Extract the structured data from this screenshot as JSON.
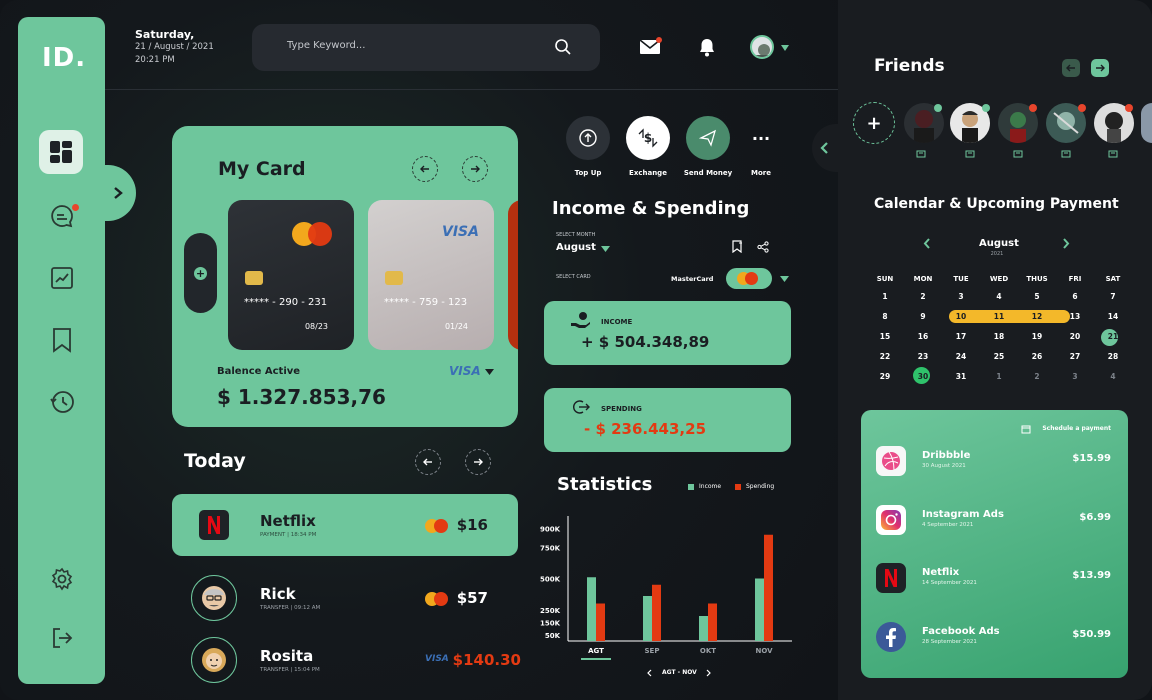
{
  "logo": "ID.",
  "datetime": {
    "day": "Saturday,",
    "date": "21 / August / 2021",
    "time": "20:21 PM"
  },
  "search": {
    "placeholder": "Type Keyword..."
  },
  "my_card": {
    "title": "My Card",
    "cards": [
      {
        "number": "***** - 290 - 231",
        "expiry": "08/23",
        "brand": "mastercard"
      },
      {
        "number": "***** - 759 - 123",
        "expiry": "01/24",
        "brand": "VISA"
      }
    ],
    "balance_label": "Balence Active",
    "balance": "$ 1.327.853,76",
    "brand_label": "VISA"
  },
  "today": {
    "title": "Today",
    "transactions": [
      {
        "name": "Netflix",
        "sub": "PAYMENT | 18:34 PM",
        "amount": "$16",
        "method": "mastercard"
      },
      {
        "name": "Rick",
        "sub": "TRANSFER | 09:12 AM",
        "amount": "$57",
        "method": "mastercard"
      },
      {
        "name": "Rosita",
        "sub": "TRANSFER | 15:04 PM",
        "amount": "$140.30",
        "method": "VISA"
      }
    ]
  },
  "quick_actions": [
    {
      "label": "Top Up"
    },
    {
      "label": "Exchange"
    },
    {
      "label": "Send Money"
    },
    {
      "label": "More",
      "icon": "···"
    }
  ],
  "income_spending": {
    "title": "Income & Spending",
    "month_label": "SELECT MONTH",
    "month": "August",
    "card_label": "SELECT CARD",
    "card": "MasterCard",
    "income_label": "INCOME",
    "income": "+ $ 504.348,89",
    "spending_label": "SPENDING",
    "spending": "- $ 236.443,25"
  },
  "statistics": {
    "title": "Statistics",
    "range_label": "AGT - NOV"
  },
  "chart_data": {
    "type": "bar",
    "title": "Statistics",
    "categories": [
      "AGT",
      "SEP",
      "OKT",
      "NOV"
    ],
    "series": [
      {
        "name": "Income",
        "values": [
          510,
          360,
          200,
          500
        ],
        "color": "#6ec69c"
      },
      {
        "name": "Spending",
        "values": [
          300,
          450,
          300,
          850
        ],
        "color": "#e33a12"
      }
    ],
    "y_ticks": [
      "900K",
      "750K",
      "500K",
      "250K",
      "150K",
      "50K"
    ],
    "ylim": [
      0,
      1000
    ],
    "selected_category": "AGT"
  },
  "friends": {
    "title": "Friends",
    "add_label": "+",
    "people": [
      {
        "status": "online",
        "color": "#2b2f33"
      },
      {
        "status": "online",
        "color": "#e8e8e8"
      },
      {
        "status": "busy",
        "color": "#2f3a3a"
      },
      {
        "status": "busy",
        "color": "#3c5a55"
      },
      {
        "status": "busy",
        "color": "#dddddd"
      }
    ]
  },
  "calendar": {
    "title": "Calendar & Upcoming Payment",
    "month": "August",
    "year": "2021",
    "weekdays": [
      "SUN",
      "MON",
      "TUE",
      "WED",
      "THUS",
      "FRI",
      "SAT"
    ],
    "rows": [
      [
        "1",
        "2",
        "3",
        "4",
        "5",
        "6",
        "7"
      ],
      [
        "8",
        "9",
        "10",
        "11",
        "12",
        "13",
        "14"
      ],
      [
        "15",
        "16",
        "17",
        "18",
        "19",
        "20",
        "21"
      ],
      [
        "22",
        "23",
        "24",
        "25",
        "26",
        "27",
        "28"
      ],
      [
        "29",
        "30",
        "31",
        "1",
        "2",
        "3",
        "4"
      ]
    ]
  },
  "schedule": {
    "header": "Schedule a payment",
    "payments": [
      {
        "name": "Dribbble",
        "date": "30 August 2021",
        "amount": "$15.99",
        "icon": "dribbble-icon"
      },
      {
        "name": "Instagram Ads",
        "date": "4 September 2021",
        "amount": "$6.99",
        "icon": "instagram-icon"
      },
      {
        "name": "Netflix",
        "date": "14 September 2021",
        "amount": "$13.99",
        "icon": "netflix-icon"
      },
      {
        "name": "Facebook Ads",
        "date": "28 September 2021",
        "amount": "$50.99",
        "icon": "facebook-icon"
      }
    ]
  },
  "colors": {
    "accent": "#6ec69c",
    "danger": "#e33a12",
    "bg": "#111418",
    "panel": "#191c20"
  }
}
